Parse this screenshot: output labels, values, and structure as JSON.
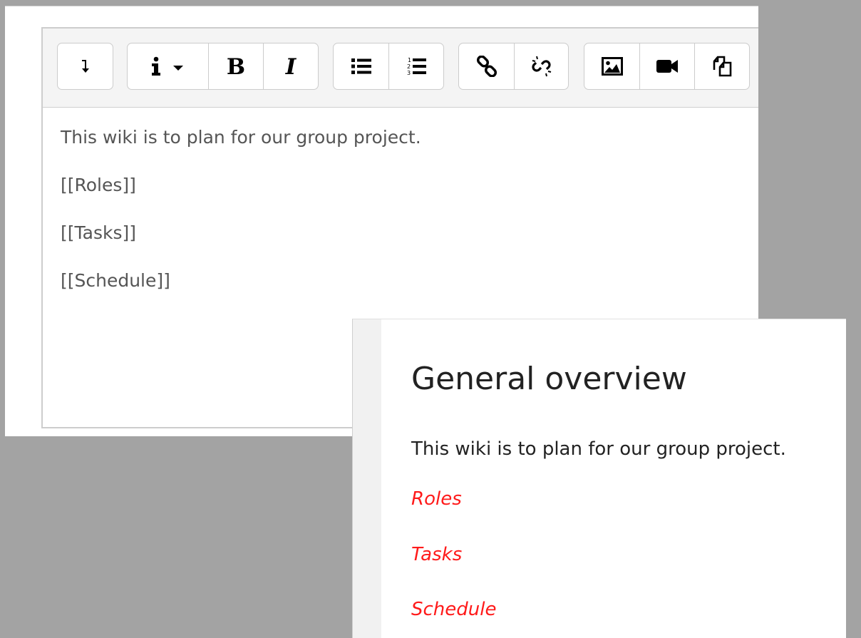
{
  "editor": {
    "toolbar": {
      "buttons": {
        "show_more": "show-more-buttons-icon",
        "paragraph_styles": "info-icon",
        "bold": "bold-icon",
        "italic": "italic-icon",
        "unordered_list": "unordered-list-icon",
        "ordered_list": "ordered-list-icon",
        "link": "link-icon",
        "unlink": "unlink-icon",
        "image": "image-icon",
        "media": "video-icon",
        "manage_files": "copy-files-icon"
      }
    },
    "content": {
      "line1": "This wiki is to plan for our group project.",
      "line2": "[[Roles]]",
      "line3": "[[Tasks]]",
      "line4": "[[Schedule]]"
    }
  },
  "preview": {
    "title": "General overview",
    "intro": "This wiki is to plan for our group project.",
    "links": {
      "roles": "Roles",
      "tasks": "Tasks",
      "schedule": "Schedule"
    }
  },
  "colors": {
    "background": "#a3a3a3",
    "toolbar": "#f4f4f4",
    "editor_text": "#555555",
    "preview_text": "#222222",
    "wiki_link_missing": "#ff1a1a"
  }
}
